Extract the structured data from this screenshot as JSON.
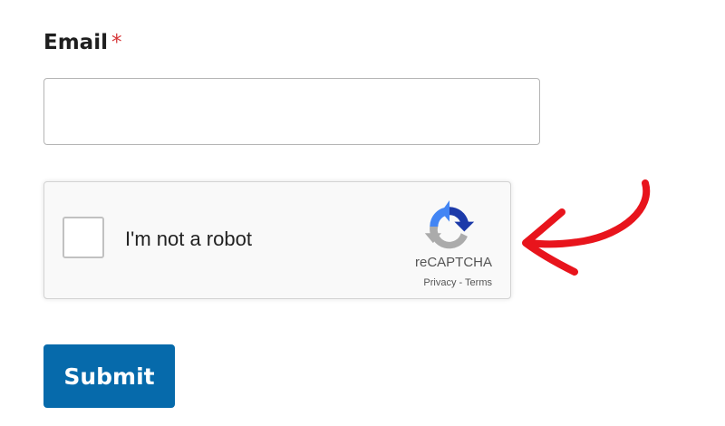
{
  "form": {
    "email_label": "Email",
    "required_marker": "*",
    "email_value": "",
    "submit_label": "Submit"
  },
  "recaptcha": {
    "label": "I'm not a robot",
    "checked": false,
    "brand": "reCAPTCHA",
    "privacy_link": "Privacy",
    "separator": " - ",
    "terms_link": "Terms",
    "logo_icon": "recaptcha-logo-icon"
  },
  "annotation": {
    "icon": "hand-drawn-arrow-icon",
    "color": "#e8141c"
  },
  "colors": {
    "submit_bg": "#066aab",
    "required": "#d63638",
    "recaptcha_blue": "#1c3aa9",
    "recaptcha_light_blue": "#4285f4",
    "recaptcha_gray": "#ababab"
  }
}
